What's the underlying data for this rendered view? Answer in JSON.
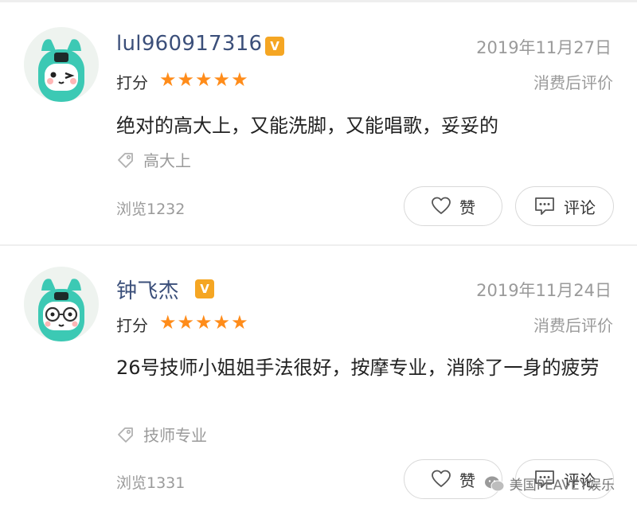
{
  "reviews": [
    {
      "username": "lul960917316",
      "badge": "V",
      "date": "2019年11月27日",
      "score_label": "打分",
      "stars": 5,
      "after_label": "消费后评价",
      "content": "绝对的高大上，又能洗脚，又能唱歌，妥妥的",
      "tag": "高大上",
      "views": "浏览1232",
      "like_label": "赞",
      "comment_label": "评论",
      "avatar_icon": "cartoon-avatar-wink-icon"
    },
    {
      "username": "钟飞杰",
      "badge": "V",
      "date": "2019年11月24日",
      "score_label": "打分",
      "stars": 5,
      "after_label": "消费后评价",
      "content": "26号技师小姐姐手法很好，按摩专业，消除了一身的疲劳",
      "tag": "技师专业",
      "views": "浏览1331",
      "like_label": "赞",
      "comment_label": "评论",
      "avatar_icon": "cartoon-avatar-glasses-icon"
    }
  ],
  "watermark": "美国PEAVEY娱乐",
  "colors": {
    "username": "#3b4f7a",
    "star": "#ff8c1a",
    "badge": "#f5a623",
    "avatar_teal": "#3cc9b4",
    "muted_text": "#9a9a9a"
  }
}
